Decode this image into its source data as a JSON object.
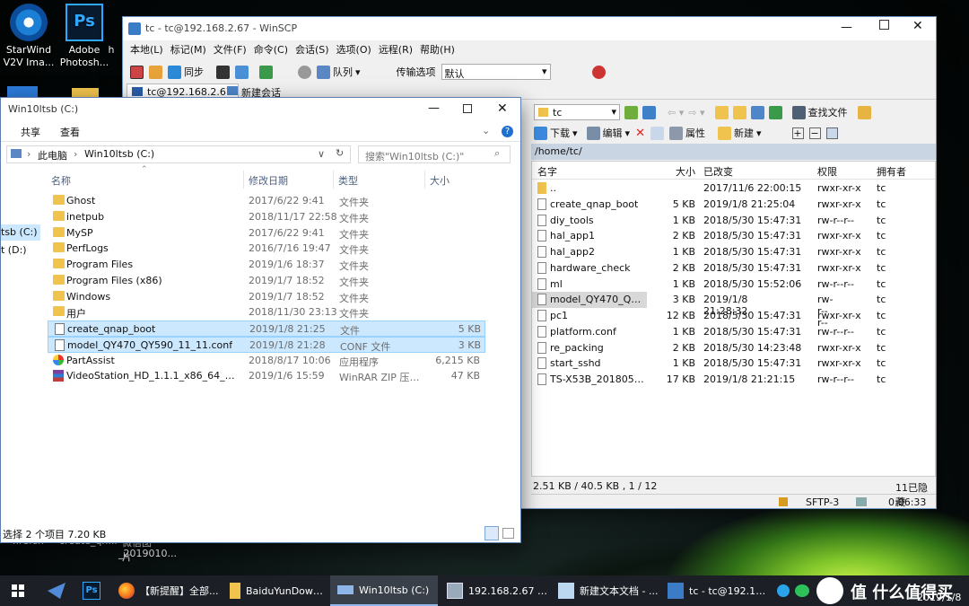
{
  "desktop": {
    "icons": [
      {
        "label1": "StarWind",
        "label2": "V2V Ima..."
      },
      {
        "label1": "Adobe",
        "label2": "Photosh..."
      },
      {
        "label1": "h",
        "label2": ""
      }
    ],
    "bottom_icons": [
      "firefox",
      "create_qn...",
      "微信图片",
      "_2019010..."
    ]
  },
  "winscp": {
    "title": "tc - tc@192.168.2.67 - WinSCP",
    "menu": [
      "本地(L)",
      "标记(M)",
      "文件(F)",
      "命令(C)",
      "会话(S)",
      "选项(O)",
      "远程(R)",
      "帮助(H)"
    ],
    "toolbar": {
      "sync": "同步",
      "queue": "队列",
      "transfer_label": "传输选项",
      "transfer_value": "默认"
    },
    "session_tab": "tc@192.168.2.67",
    "new_session": "新建会话",
    "remote_dir": "tc",
    "find_files": "查找文件",
    "actions": {
      "download": "下载",
      "edit": "编辑",
      "properties": "属性",
      "new": "新建"
    },
    "path": "/home/tc/",
    "columns": [
      "名字",
      "大小",
      "已改变",
      "权限",
      "拥有者"
    ],
    "files": [
      {
        "name": "..",
        "size": "",
        "changed": "2017/11/6 22:00:15",
        "perms": "rwxr-xr-x",
        "owner": "tc"
      },
      {
        "name": "create_qnap_boot",
        "size": "5 KB",
        "changed": "2019/1/8 21:25:04",
        "perms": "rwxr-xr-x",
        "owner": "tc"
      },
      {
        "name": "diy_tools",
        "size": "1 KB",
        "changed": "2018/5/30 15:47:31",
        "perms": "rw-r--r--",
        "owner": "tc"
      },
      {
        "name": "hal_app1",
        "size": "2 KB",
        "changed": "2018/5/30 15:47:31",
        "perms": "rwxr-xr-x",
        "owner": "tc"
      },
      {
        "name": "hal_app2",
        "size": "1 KB",
        "changed": "2018/5/30 15:47:31",
        "perms": "rwxr-xr-x",
        "owner": "tc"
      },
      {
        "name": "hardware_check",
        "size": "2 KB",
        "changed": "2018/5/30 15:47:31",
        "perms": "rwxr-xr-x",
        "owner": "tc"
      },
      {
        "name": "ml",
        "size": "1 KB",
        "changed": "2018/5/30 15:52:06",
        "perms": "rw-r--r--",
        "owner": "tc"
      },
      {
        "name": "model_QY470_QY5...",
        "size": "3 KB",
        "changed": "2019/1/8 21:28:32",
        "perms": "rw-r--r--",
        "owner": "tc"
      },
      {
        "name": "pc1",
        "size": "12 KB",
        "changed": "2018/5/30 15:47:31",
        "perms": "rwxr-xr-x",
        "owner": "tc"
      },
      {
        "name": "platform.conf",
        "size": "1 KB",
        "changed": "2018/5/30 15:47:31",
        "perms": "rw-r--r--",
        "owner": "tc"
      },
      {
        "name": "re_packing",
        "size": "2 KB",
        "changed": "2018/5/30 14:23:48",
        "perms": "rwxr-xr-x",
        "owner": "tc"
      },
      {
        "name": "start_sshd",
        "size": "1 KB",
        "changed": "2018/5/30 15:47:31",
        "perms": "rwxr-xr-x",
        "owner": "tc"
      },
      {
        "name": "TS-X53B_20180528-...",
        "size": "17 KB",
        "changed": "2019/1/8 21:21:15",
        "perms": "rw-r--r--",
        "owner": "tc"
      }
    ],
    "status": {
      "summary": "2.51 KB / 40.5 KB , 1 / 12",
      "hidden": "11已隐藏",
      "protocol": "SFTP-3",
      "time": "0:06:33"
    }
  },
  "explorer": {
    "title": "Win10ltsb (C:)",
    "ribbon": [
      "共享",
      "查看"
    ],
    "breadcrumb": [
      "此电脑",
      "Win10ltsb (C:)"
    ],
    "search_placeholder": "搜索\"Win10ltsb (C:)\"",
    "columns": [
      "名称",
      "修改日期",
      "类型",
      "大小"
    ],
    "nav": [
      "tsb (C:)",
      "t (D:)"
    ],
    "files": [
      {
        "name": "Ghost",
        "date": "2017/6/22 9:41",
        "type": "文件夹",
        "size": "",
        "kind": "folder"
      },
      {
        "name": "inetpub",
        "date": "2018/11/17 22:58",
        "type": "文件夹",
        "size": "",
        "kind": "folder"
      },
      {
        "name": "MySP",
        "date": "2017/6/22 9:41",
        "type": "文件夹",
        "size": "",
        "kind": "folder"
      },
      {
        "name": "PerfLogs",
        "date": "2016/7/16 19:47",
        "type": "文件夹",
        "size": "",
        "kind": "folder"
      },
      {
        "name": "Program Files",
        "date": "2019/1/6 18:37",
        "type": "文件夹",
        "size": "",
        "kind": "folder"
      },
      {
        "name": "Program Files (x86)",
        "date": "2019/1/7 18:52",
        "type": "文件夹",
        "size": "",
        "kind": "folder"
      },
      {
        "name": "Windows",
        "date": "2019/1/7 18:52",
        "type": "文件夹",
        "size": "",
        "kind": "folder"
      },
      {
        "name": "用户",
        "date": "2018/11/30 23:13",
        "type": "文件夹",
        "size": "",
        "kind": "folder"
      },
      {
        "name": "create_qnap_boot",
        "date": "2019/1/8 21:25",
        "type": "文件",
        "size": "5 KB",
        "kind": "doc"
      },
      {
        "name": "model_QY470_QY590_11_11.conf",
        "date": "2019/1/8 21:28",
        "type": "CONF 文件",
        "size": "3 KB",
        "kind": "doc"
      },
      {
        "name": "PartAssist",
        "date": "2018/8/17 10:06",
        "type": "应用程序",
        "size": "6,215 KB",
        "kind": "app"
      },
      {
        "name": "VideoStation_HD_1.1.1_x86_64_20180...",
        "date": "2019/1/6 15:59",
        "type": "WinRAR ZIP 压缩...",
        "size": "47 KB",
        "kind": "zip"
      }
    ],
    "status": "选择 2 个项目  7.20 KB"
  },
  "taskbar": {
    "items": [
      "【新提醒】全部...",
      "BaiduYunDown...",
      "Win10ltsb (C:)",
      "192.168.2.67 (1...",
      "新建文本文档 - ...",
      "tc - tc@192.16..."
    ],
    "watermark": "值 什么值得买",
    "date": "2019/1/8"
  }
}
